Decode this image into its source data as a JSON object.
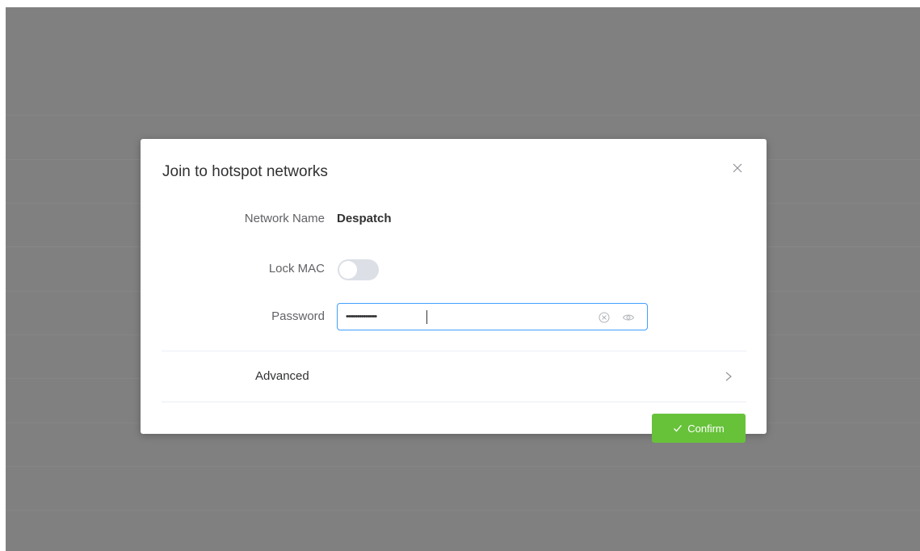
{
  "dialog": {
    "title": "Join to hotspot networks",
    "network_name_label": "Network Name",
    "network_name_value": "Despatch",
    "lock_mac_label": "Lock MAC",
    "lock_mac_on": false,
    "password_label": "Password",
    "password_masked": "••••••••••••••••",
    "advanced_label": "Advanced",
    "confirm_label": "Confirm"
  },
  "icons": {
    "close": "close-icon",
    "clear": "clear-circle-icon",
    "show_password": "eye-icon",
    "advanced_chevron": "chevron-right-icon",
    "confirm_check": "check-icon"
  },
  "colors": {
    "overlay": "#808080",
    "confirm": "#67c23a",
    "input_focus_border": "#409eff",
    "switch_off": "#dcdfe6"
  }
}
